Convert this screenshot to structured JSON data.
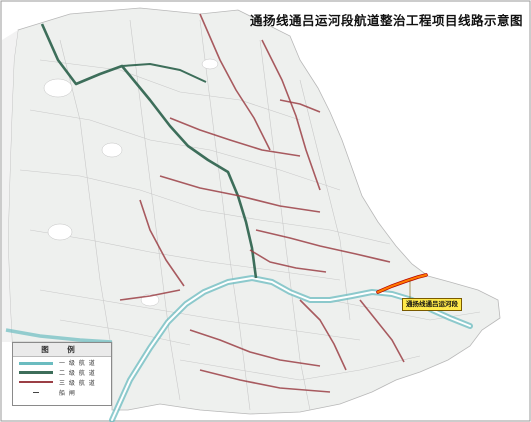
{
  "title": "通扬线通吕运河段航道整治工程项目线路示意图",
  "callout": {
    "label": "通扬线通吕运河段"
  },
  "legend": {
    "title": "图 例",
    "items": [
      {
        "label": "一 级 航 道",
        "color": "#6bbcc0",
        "style": "double"
      },
      {
        "label": "二 级 航 道",
        "color": "#3d6e5a",
        "style": "thick"
      },
      {
        "label": "三 级 航 道",
        "color": "#9b3f45",
        "style": "medium"
      },
      {
        "label": "船 闸",
        "color": "#444444",
        "style": "tick"
      }
    ]
  },
  "colors": {
    "land": "#eef0ee",
    "water": "#ffffff",
    "sea": "#ffffff",
    "frame": "#9a9a9a",
    "grade1": "#6bbcc0",
    "grade2": "#3d6e5a",
    "grade3": "#9b3f45",
    "highlight": "#ff7a00",
    "roads": "#c9c9c9"
  }
}
